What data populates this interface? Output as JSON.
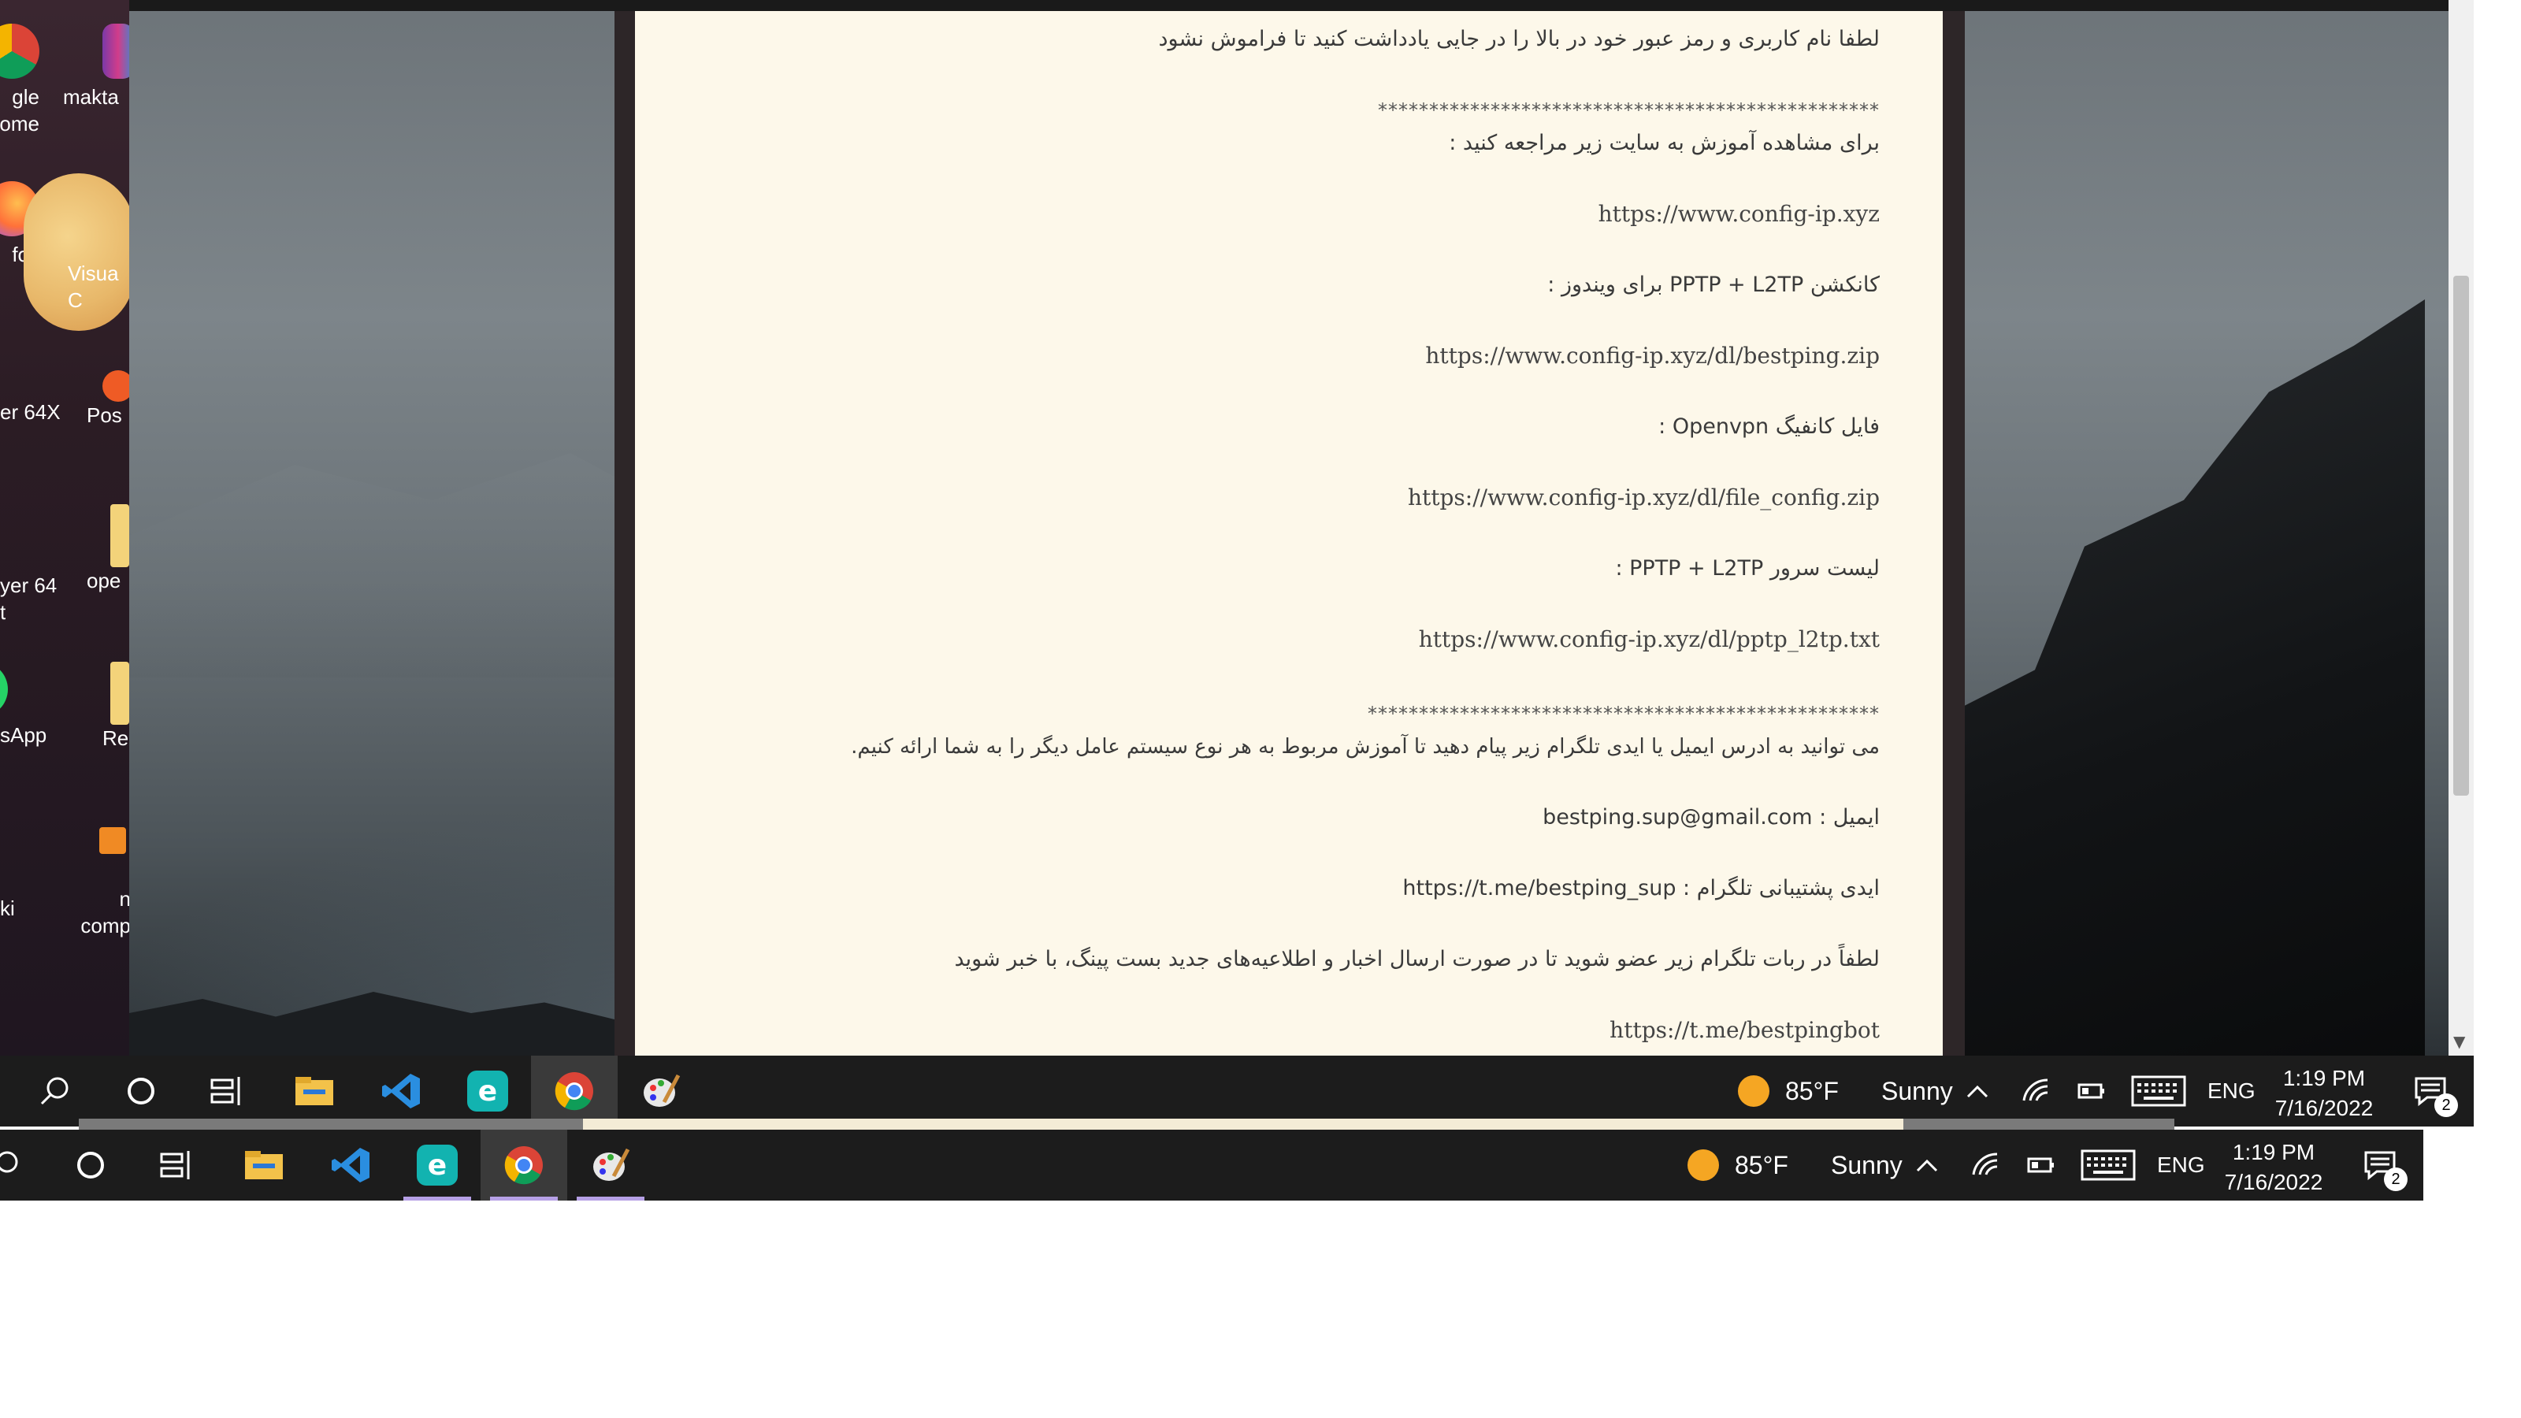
{
  "desktop": {
    "icons": [
      {
        "label": "gle\nome",
        "icon": "chrome-icon"
      },
      {
        "label": "makta",
        "icon": "winrar-icon"
      },
      {
        "label": "fox",
        "icon": "firefox-icon"
      },
      {
        "label": "Visua\nC",
        "icon": "vscode-icon"
      },
      {
        "label": "er 64X",
        "icon": "media-player-icon"
      },
      {
        "label": "Pos",
        "icon": "postman-icon"
      },
      {
        "label": "yer 64\nt",
        "icon": "potplayer-icon"
      },
      {
        "label": "ope",
        "icon": "folder-icon"
      },
      {
        "label": "sApp",
        "icon": "whatsapp-icon"
      },
      {
        "label": "Re",
        "icon": "folder-icon"
      },
      {
        "label": "ki",
        "icon": "app-icon"
      },
      {
        "label": "n\ncomp",
        "icon": "network-icon"
      }
    ]
  },
  "document": {
    "lines": [
      {
        "text": "لطفا نام کاربری و رمز عبور خود در بالا را در جایی یادداشت کنید تا فراموش نشود",
        "kind": "text"
      },
      {
        "text": "*************************************************",
        "kind": "stars"
      },
      {
        "text": "برای مشاهده آموزش به سایت زیر مراجعه کنید :",
        "kind": "text"
      },
      {
        "text": "https://www.config-ip.xyz",
        "kind": "url"
      },
      {
        "text": "کانکشن PPTP + L2TP برای ویندوز :",
        "kind": "text"
      },
      {
        "text": "https://www.config-ip.xyz/dl/bestping.zip",
        "kind": "url"
      },
      {
        "text": "فایل کانفیگ Openvpn :",
        "kind": "text"
      },
      {
        "text": "https://www.config-ip.xyz/dl/file_config.zip",
        "kind": "url"
      },
      {
        "text": "لیست سرور PPTP + L2TP :",
        "kind": "text"
      },
      {
        "text": "https://www.config-ip.xyz/dl/pptp_l2tp.txt",
        "kind": "url"
      },
      {
        "text": "**************************************************",
        "kind": "stars"
      },
      {
        "text": "می توانید به ادرس ایمیل یا ایدی تلگرام زیر پیام دهید تا آموزش مربوط به هر نوع سیستم عامل دیگر را به شما ارائه کنیم.",
        "kind": "text"
      },
      {
        "text": "ایمیل : bestping.sup@gmail.com",
        "kind": "text"
      },
      {
        "text": "ایدی پشتیبانی تلگرام : https://t.me/bestping_sup",
        "kind": "text"
      },
      {
        "text": "لطفاً در ربات تلگرام زیر عضو شوید تا در صورت ارسال اخبار و اطلاعیه‌های جدید بست پینگ، با خبر شوید",
        "kind": "text"
      },
      {
        "text": "https://t.me/bestpingbot",
        "kind": "url"
      }
    ]
  },
  "taskbar_top": {
    "weather_temp": "85°F",
    "weather_desc": "Sunny",
    "language": "ENG",
    "time": "1:19 PM",
    "date": "7/16/2022",
    "notifications": "2"
  },
  "taskbar_bottom": {
    "weather_temp": "85°F",
    "weather_desc": "Sunny",
    "language": "ENG",
    "time": "1:19 PM",
    "date": "7/16/2022",
    "notifications": "2"
  },
  "colors": {
    "taskbar": "#1c1c1c",
    "page": "#fdf8ea",
    "open_indicator": "#b6a0e6",
    "weather_sun": "#f5a623"
  }
}
